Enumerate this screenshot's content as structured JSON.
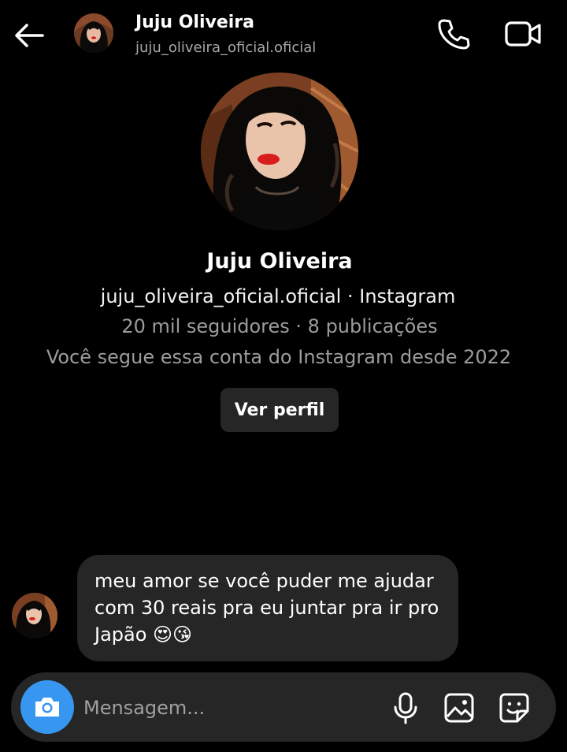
{
  "header": {
    "name": "Juju Oliveira",
    "handle": "juju_oliveira_oficial.oficial",
    "back_icon": "arrow-left-icon",
    "call_icon": "phone-icon",
    "video_icon": "video-camera-icon"
  },
  "profile": {
    "name": "Juju Oliveira",
    "line1": "juju_oliveira_oficial.oficial · Instagram",
    "line2": "20 mil seguidores · 8 publicações",
    "line3": "Você segue essa conta do Instagram desde 2022",
    "view_button": "Ver perfil"
  },
  "message": {
    "line1": "meu amor se você puder me ajudar",
    "line2": "com 30 reais pra eu juntar pra ir pro",
    "line3": "Japão 😍😘"
  },
  "composer": {
    "placeholder": "Mensagem...",
    "camera_icon": "camera-icon",
    "mic_icon": "microphone-icon",
    "gallery_icon": "image-icon",
    "sticker_icon": "sticker-icon"
  },
  "colors": {
    "background": "#000000",
    "bubble": "#262626",
    "accent": "#3797f0",
    "muted_text": "#9c9c9c"
  }
}
